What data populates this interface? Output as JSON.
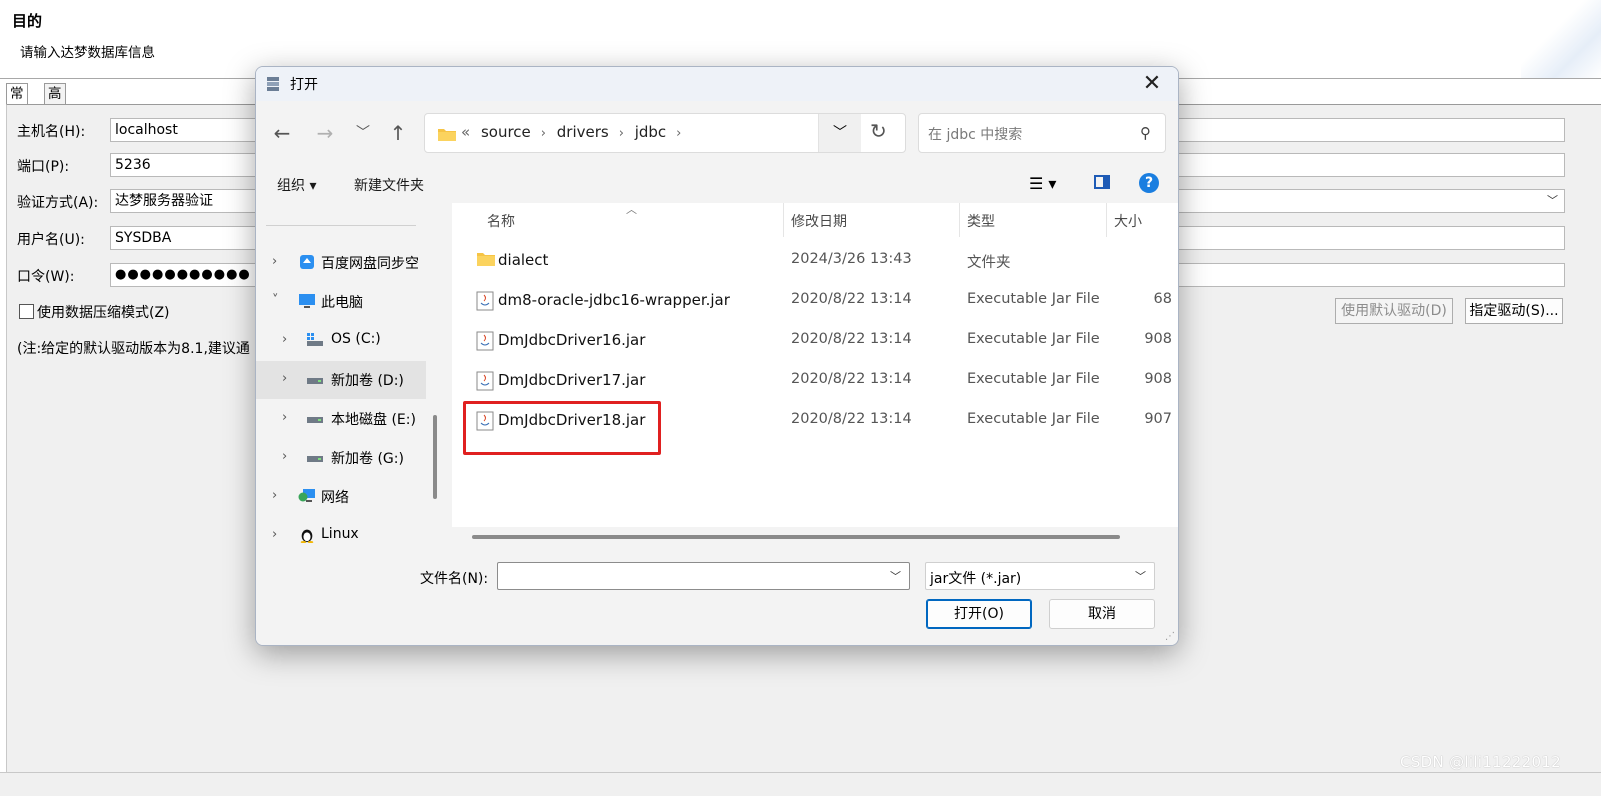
{
  "wizard": {
    "title": "目的",
    "subtitle": "请输入达梦数据库信息",
    "tabs": [
      "常规",
      "高级"
    ],
    "fields": [
      {
        "label": "主机名(H):",
        "value": "localhost"
      },
      {
        "label": "端口(P):",
        "value": "5236"
      },
      {
        "label": "验证方式(A):",
        "value": "达梦服务器验证"
      },
      {
        "label": "用户名(U):",
        "value": "SYSDBA"
      },
      {
        "label": "口令(W):",
        "value": "●●●●●●●●●●●"
      }
    ],
    "compress_label": "使用数据压缩模式(Z)",
    "note": "(注:给定的默认驱动版本为8.1,建议通",
    "default_driver_label": "使用默认驱动(D)",
    "specify_driver_label": "指定驱动(S)..."
  },
  "dialog": {
    "title": "打开",
    "breadcrumb": [
      "source",
      "drivers",
      "jdbc"
    ],
    "breadcrumb_prefix": "«",
    "search_placeholder": "在 jdbc 中搜索",
    "organize_label": "组织 ▾",
    "new_folder_label": "新建文件夹",
    "help_symbol": "?",
    "nav": [
      {
        "label": "百度网盘同步空",
        "icon": "baidu-netdisk-icon"
      },
      {
        "label": "此电脑",
        "icon": "computer-icon"
      },
      {
        "label": "OS (C:)",
        "icon": "windows-drive-icon"
      },
      {
        "label": "新加卷 (D:)",
        "icon": "drive-icon",
        "selected": true
      },
      {
        "label": "本地磁盘 (E:)",
        "icon": "drive-icon"
      },
      {
        "label": "新加卷 (G:)",
        "icon": "drive-icon"
      },
      {
        "label": "网络",
        "icon": "network-icon"
      },
      {
        "label": "Linux",
        "icon": "linux-penguin-icon"
      }
    ],
    "columns": {
      "name": "名称",
      "modified": "修改日期",
      "type": "类型",
      "size": "大小"
    },
    "files": [
      {
        "name": "dialect",
        "modified": "2024/3/26 13:43",
        "type": "文件夹",
        "size": "",
        "icon": "folder-icon"
      },
      {
        "name": "dm8-oracle-jdbc16-wrapper.jar",
        "modified": "2020/8/22 13:14",
        "type": "Executable Jar File",
        "size": "68",
        "icon": "jar-file-icon"
      },
      {
        "name": "DmJdbcDriver16.jar",
        "modified": "2020/8/22 13:14",
        "type": "Executable Jar File",
        "size": "908",
        "icon": "jar-file-icon"
      },
      {
        "name": "DmJdbcDriver17.jar",
        "modified": "2020/8/22 13:14",
        "type": "Executable Jar File",
        "size": "908",
        "icon": "jar-file-icon"
      },
      {
        "name": "DmJdbcDriver18.jar",
        "modified": "2020/8/22 13:14",
        "type": "Executable Jar File",
        "size": "907",
        "icon": "jar-file-icon"
      }
    ],
    "filename_label": "文件名(N):",
    "filename_value": "",
    "filter_value": "jar文件 (*.jar)",
    "open_label": "打开(O)",
    "cancel_label": "取消"
  },
  "watermark": "CSDN @lili11222012",
  "colors": {
    "highlight": "#e02020",
    "accent": "#0067c0"
  }
}
